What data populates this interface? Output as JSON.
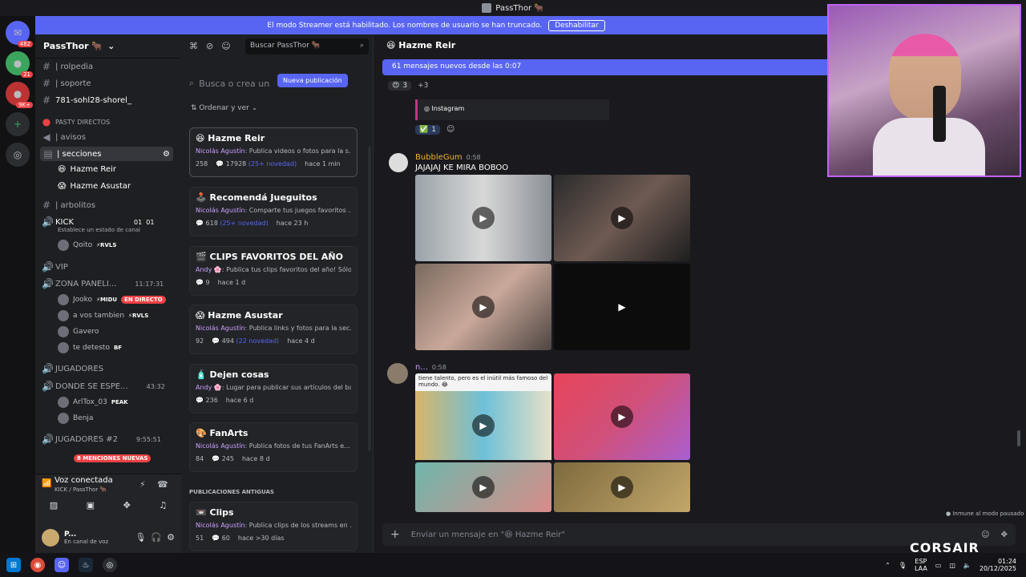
{
  "window": {
    "title": "PassThor 🐂"
  },
  "banner": {
    "text": "El modo Streamer está habilitado. Los nombres de usuario se han truncado.",
    "button": "Deshabilitar"
  },
  "servers": {
    "badges": [
      "482",
      "21",
      "9K+"
    ]
  },
  "server": {
    "name": "PassThor 🐂"
  },
  "channels": [
    {
      "label": "| rolpedia",
      "prefix": "#"
    },
    {
      "label": "| soporte",
      "prefix": "#"
    },
    {
      "label": "781-sohl28-shorel_",
      "prefix": "#"
    },
    {
      "label": "PASTY DIRECTOS",
      "prefix": ""
    },
    {
      "label": "| avisos",
      "prefix": ""
    },
    {
      "label": "| secciones",
      "prefix": ""
    },
    {
      "label": "Hazme Reir",
      "prefix": ""
    },
    {
      "label": "Hazme Asustar",
      "prefix": ""
    },
    {
      "label": "| arbolitos",
      "prefix": "#"
    },
    {
      "label": "KICK",
      "prefix": ""
    },
    {
      "label": "Establece un estado de canal",
      "prefix": ""
    },
    {
      "label": "VIP",
      "prefix": ""
    },
    {
      "label": "ZONA PANELI...",
      "prefix": ""
    },
    {
      "label": "JUGADORES",
      "prefix": ""
    },
    {
      "label": "DONDE SE ESPE...",
      "prefix": ""
    },
    {
      "label": "JUGADORES #2",
      "prefix": ""
    }
  ],
  "kick_counts": [
    "01",
    "01"
  ],
  "voice_users": {
    "kick": [
      {
        "name": "Qoito",
        "tag": "⚡RVLS"
      }
    ],
    "zona": [
      {
        "name": "Jooko",
        "tag": "⚡MIDU",
        "live": "EN DIRECTO"
      },
      {
        "name": "a vos tambien",
        "tag": "⚡RVLS"
      },
      {
        "name": "Gavero",
        "tag": ""
      },
      {
        "name": "te detesto",
        "tag": "BF"
      }
    ],
    "donde": [
      {
        "name": "ArlTox_03",
        "tag": "PEAK"
      },
      {
        "name": "Benja",
        "tag": ""
      }
    ]
  },
  "timers": {
    "zona": "11:17:31",
    "donde": "43:32",
    "jug2": "9:55:51"
  },
  "mentions": "8 MENCIONES NUEVAS",
  "voice": {
    "status": "Voz conectada",
    "channel": "KICK / PassThor 🐂"
  },
  "user": {
    "name": "P...",
    "status": "En canal de voz"
  },
  "forum": {
    "search_placeholder": "Buscar PassThor 🐂",
    "big_search": "Busca o crea un",
    "new_post": "Nueva publicación",
    "sort": "Ordenar y ver",
    "old_header": "PUBLICACIONES ANTIGUAS",
    "posts": [
      {
        "title": "😆 Hazme Reir",
        "author": "Nicolás Agustín",
        "desc": ": Publica videos o fotos para la s...",
        "count": "258",
        "replies": "17928",
        "new": "(25+ novedad)",
        "time": "hace 1 min"
      },
      {
        "title": "🕹️ Recomendá Jueguitos",
        "author": "Nicolás Agustín",
        "desc": ": Comparte tus juegos favoritos ...",
        "count": "",
        "replies": "618",
        "new": "(25+ novedad)",
        "time": "hace 23 h"
      },
      {
        "title": "🎬 CLIPS FAVORITOS DEL AÑO",
        "author": "Andy 🌸",
        "desc": ": Publica tus clips favoritos del año! Sólo ...",
        "count": "",
        "replies": "9",
        "new": "",
        "time": "hace 1 d"
      },
      {
        "title": "😱 Hazme Asustar",
        "author": "Nicolás Agustín",
        "desc": ": Publica links y fotos para la sec...",
        "count": "92",
        "replies": "494",
        "new": "(22 novedad)",
        "time": "hace 4 d"
      },
      {
        "title": "🧴 Dejen cosas",
        "author": "Andy 🌸",
        "desc": ": Lugar para publicar sus artículos del ba...",
        "count": "",
        "replies": "236",
        "new": "",
        "time": "hace 6 d"
      },
      {
        "title": "🎨 FanArts",
        "author": "Nicolás Agustín",
        "desc": ": Publica fotos de tus FanArts e...",
        "count": "84",
        "replies": "245",
        "new": "",
        "time": "hace 8 d"
      },
      {
        "title": "📼 Clips",
        "author": "Nicolás Agustín",
        "desc": ": Publica clips de los streams en ...",
        "count": "51",
        "replies": "60",
        "new": "",
        "time": "hace >30 días"
      }
    ]
  },
  "chat": {
    "title": "Hazme Reir",
    "new_messages": "61 mensajes nuevos desde las 0:07",
    "reaction_count": "3",
    "reaction_more": "+3",
    "instagram": "Instagram",
    "check_count": "1",
    "msg1": {
      "author": "BubbleGum",
      "time": "0:58",
      "text": "JAJAJAJ KE MIRA BOBOO"
    },
    "msg2": {
      "author": "n...",
      "time": "0:58",
      "caption": "tiene talento, pero es el inútil más famoso del mundo. 😂"
    },
    "composer_placeholder": "Enviar un mensaje en \"😆 Hazme Reir\"",
    "paused": "Inmune al modo pausado"
  },
  "tray": {
    "lang": "ESP",
    "layout": "LAA",
    "time": "01:24",
    "date": "20/12/2025"
  },
  "brand": "CORSAIR"
}
